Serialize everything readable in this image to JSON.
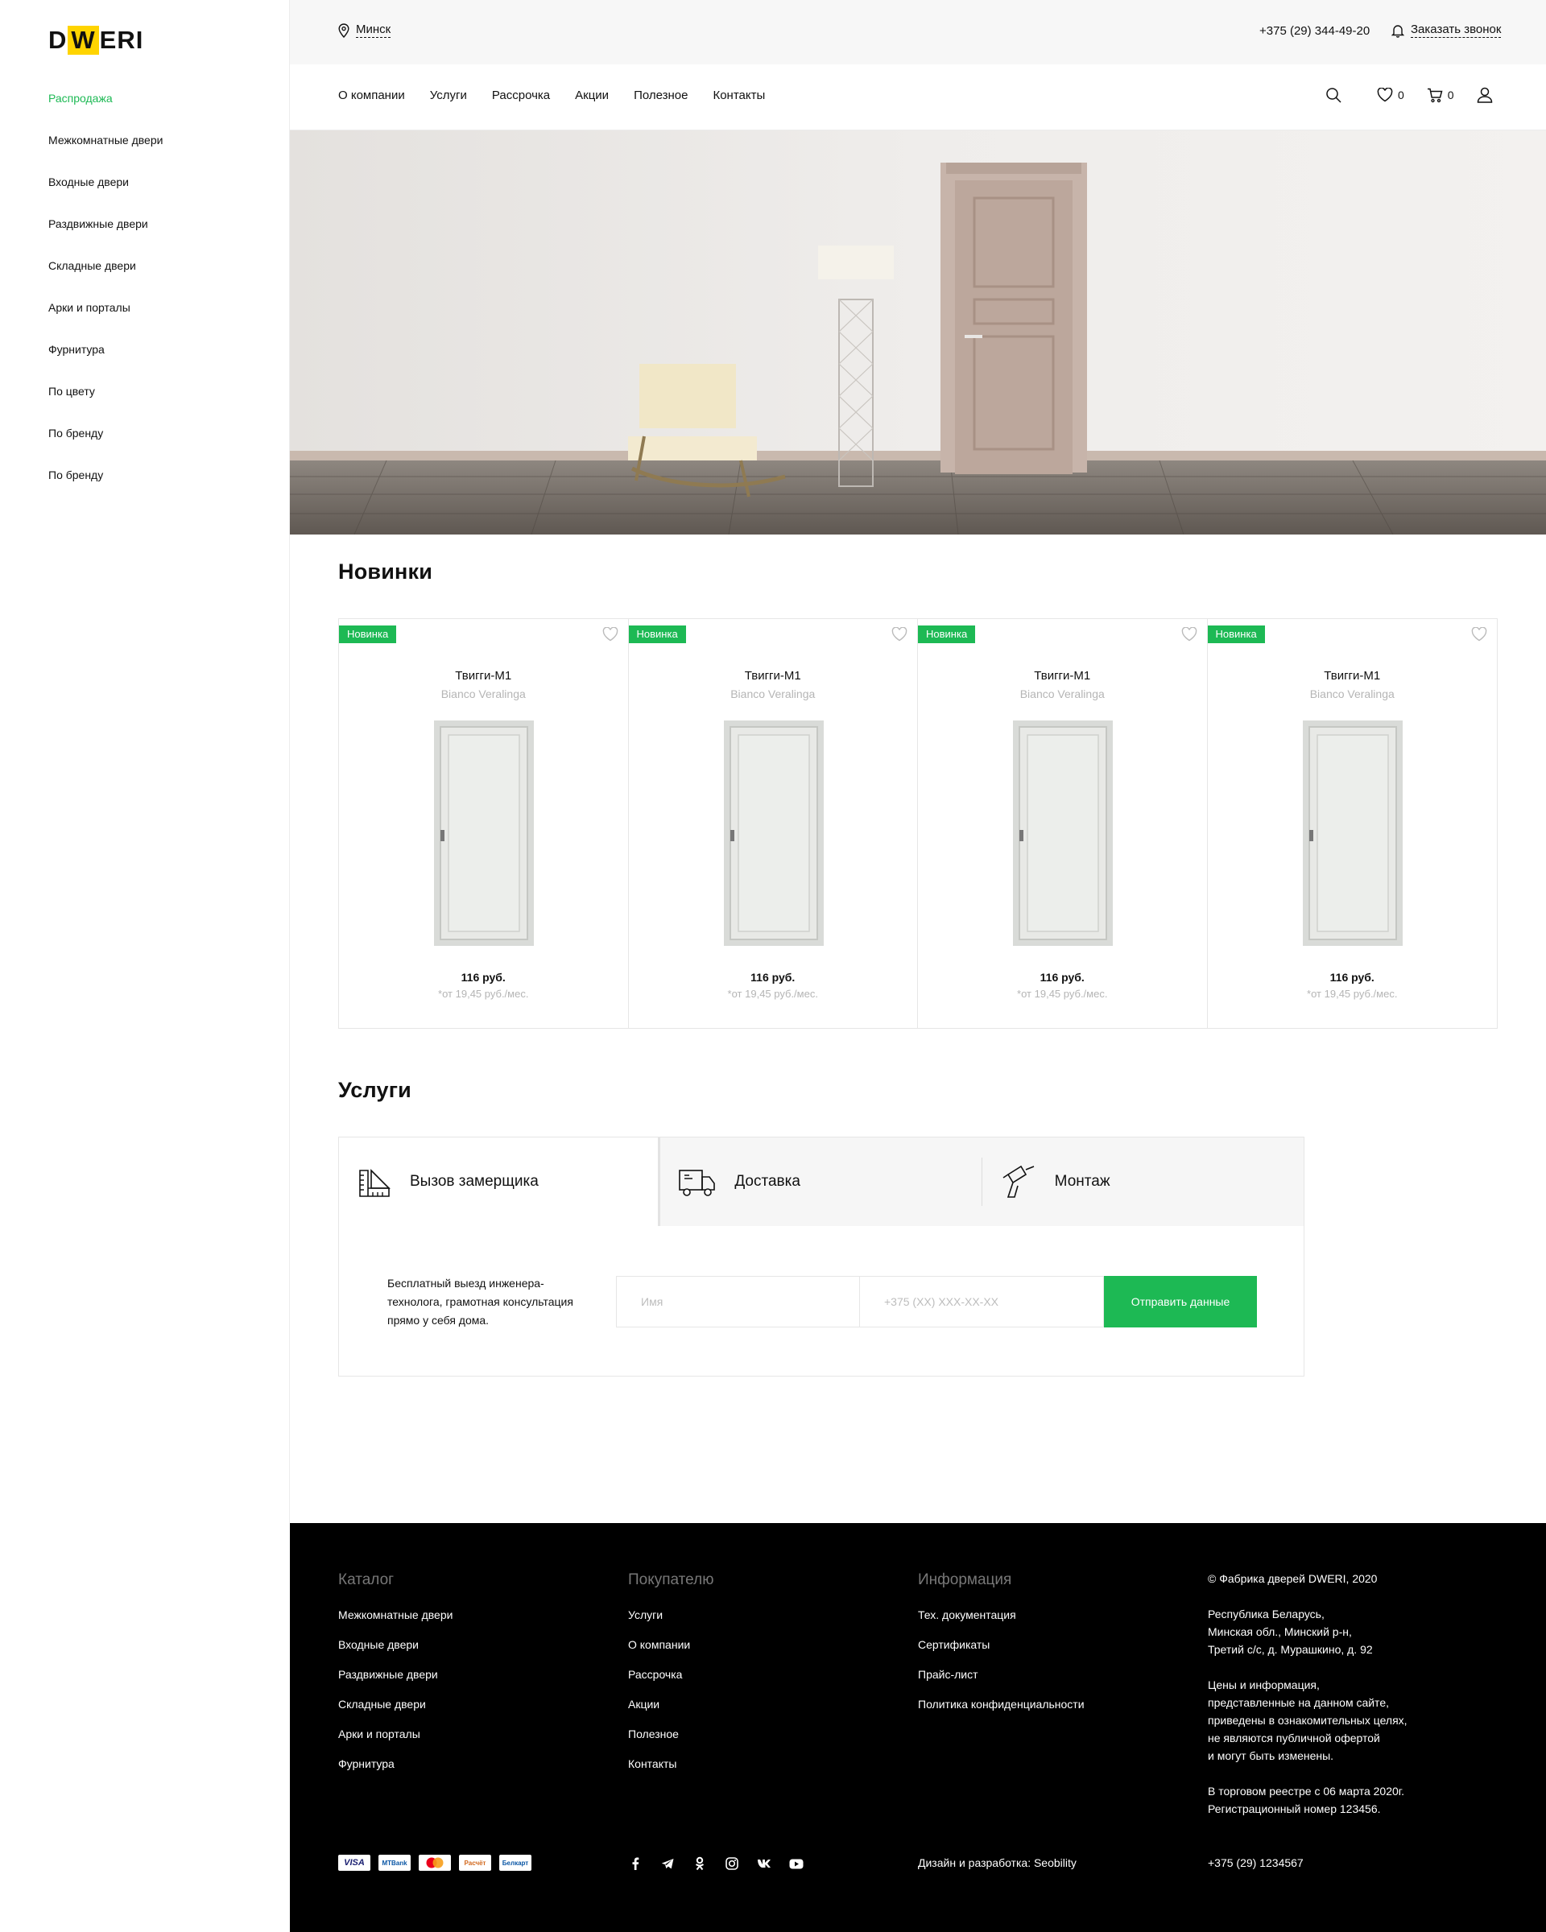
{
  "brand": {
    "logo_d": "D",
    "logo_w": "W",
    "logo_rest": "ERI",
    "accent": "#ffd400",
    "green": "#1db954"
  },
  "sidebar": {
    "items": [
      {
        "label": "Распродажа"
      },
      {
        "label": "Межкомнатные двери"
      },
      {
        "label": "Входные двери"
      },
      {
        "label": "Раздвижные двери"
      },
      {
        "label": "Складные двери"
      },
      {
        "label": "Арки и порталы"
      },
      {
        "label": "Фурнитура"
      },
      {
        "label": "По цвету"
      },
      {
        "label": "По бренду"
      },
      {
        "label": "По бренду"
      }
    ]
  },
  "topbar": {
    "city": "Минск",
    "phone": "+375 (29) 344-49-20",
    "callback": "Заказать звонок"
  },
  "menu": {
    "items": [
      {
        "label": "О компании"
      },
      {
        "label": "Услуги"
      },
      {
        "label": "Рассрочка"
      },
      {
        "label": "Акции"
      },
      {
        "label": "Полезное"
      },
      {
        "label": "Контакты"
      }
    ],
    "favorites_count": "0",
    "cart_count": "0"
  },
  "new_section": {
    "title": "Новинки",
    "products": [
      {
        "badge": "Новинка",
        "name": "Твигги-М1",
        "brand": "Bianco Veralinga",
        "price": "116 руб.",
        "credit": "от 19,45 руб./мес.",
        "credit_mark": "*"
      },
      {
        "badge": "Новинка",
        "name": "Твигги-М1",
        "brand": "Bianco Veralinga",
        "price": "116 руб.",
        "credit": "от 19,45 руб./мес.",
        "credit_mark": "*"
      },
      {
        "badge": "Новинка",
        "name": "Твигги-М1",
        "brand": "Bianco Veralinga",
        "price": "116 руб.",
        "credit": "от 19,45 руб./мес.",
        "credit_mark": "*"
      },
      {
        "badge": "Новинка",
        "name": "Твигги-М1",
        "brand": "Bianco Veralinga",
        "price": "116 руб.",
        "credit": "от 19,45 руб./мес.",
        "credit_mark": "*"
      }
    ]
  },
  "services": {
    "title": "Услуги",
    "tabs": [
      {
        "label": "Вызов замерщика",
        "icon": "ruler-icon"
      },
      {
        "label": "Доставка",
        "icon": "truck-icon"
      },
      {
        "label": "Монтаж",
        "icon": "drill-icon"
      }
    ],
    "description": "Бесплатный выезд инженера-технолога, грамотная консультация прямо у себя дома.",
    "name_placeholder": "Имя",
    "phone_placeholder": "+375 (XX) XXX-XX-XX",
    "submit": "Отправить данные"
  },
  "footer": {
    "catalog": {
      "title": "Каталог",
      "links": [
        "Межкомнатные двери",
        "Входные двери",
        "Раздвижные двери",
        "Складные двери",
        "Арки и порталы",
        "Фурнитура"
      ]
    },
    "buyer": {
      "title": "Покупателю",
      "links": [
        "Услуги",
        "О компании",
        "Рассрочка",
        "Акции",
        "Полезное",
        "Контакты"
      ]
    },
    "info": {
      "title": "Информация",
      "links": [
        "Тех. документация",
        "Сертификаты",
        "Прайс-лист",
        "Политика конфиденциальности"
      ]
    },
    "copyright": "© Фабрика дверей DWERI, 2020",
    "address": [
      "Республика Беларусь,",
      "Минская обл., Минский р-н,",
      "Третий с/с, д. Мурашкино, д. 92"
    ],
    "disclaimer": [
      "Цены и информация,",
      "представленные на данном сайте,",
      "приведены в ознакомительных целях,",
      "не являются публичной офертой",
      "и могут быть изменены."
    ],
    "registry": [
      "В торговом реестре с 06 марта 2020г.",
      "Регистрационный номер 123456."
    ],
    "payments": [
      "VISA",
      "MTBank",
      "Mastercard",
      "Расчёт",
      "Белкарт"
    ],
    "social": [
      "facebook-icon",
      "telegram-icon",
      "odnoklassniki-icon",
      "instagram-icon",
      "vk-icon",
      "youtube-icon"
    ],
    "dev_credit": "Дизайн и разработка: Seobility",
    "phone": "+375 (29) 1234567"
  }
}
